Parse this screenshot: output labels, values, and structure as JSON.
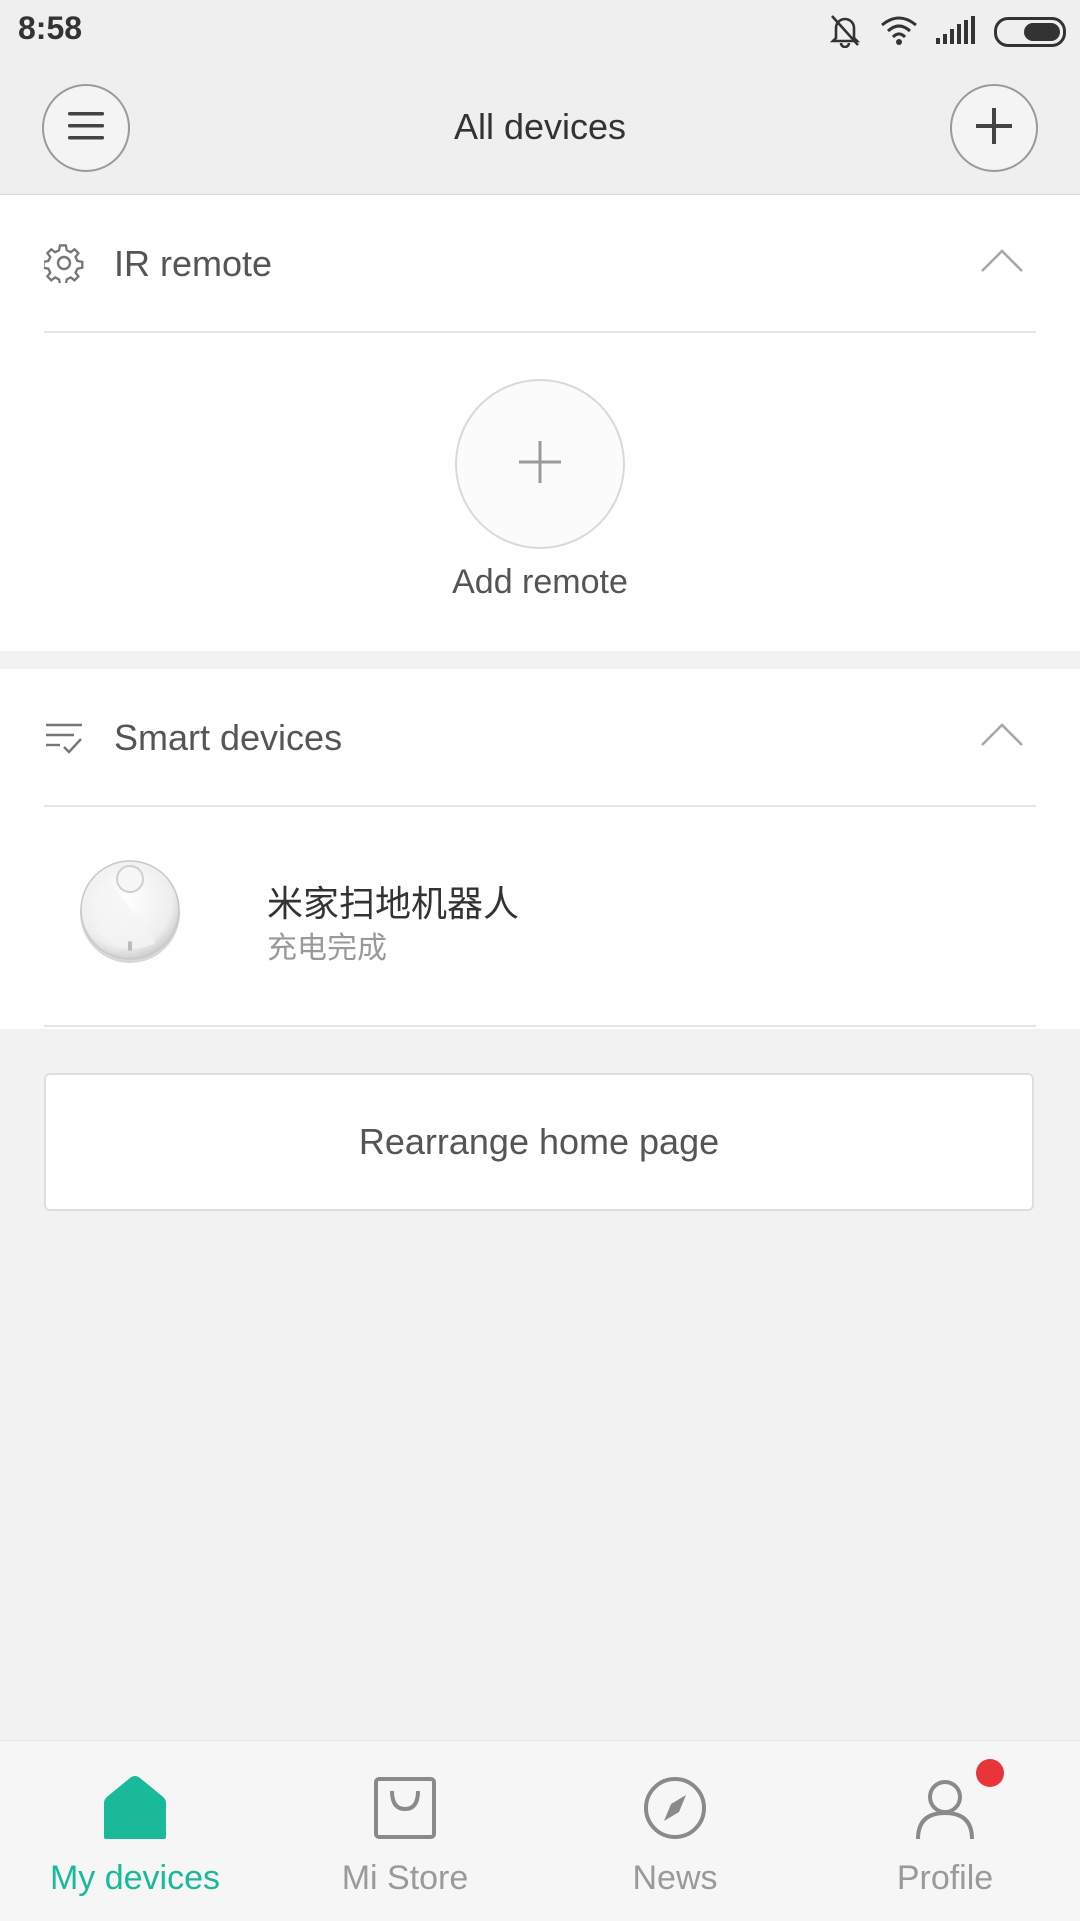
{
  "status_bar": {
    "time": "8:58"
  },
  "header": {
    "title": "All devices"
  },
  "ir_section": {
    "label": "IR remote",
    "add_label": "Add remote"
  },
  "smart_section": {
    "label": "Smart devices",
    "devices": [
      {
        "name": "米家扫地机器人",
        "status": "充电完成"
      }
    ]
  },
  "rearrange_label": "Rearrange home page",
  "tabs": [
    {
      "label": "My devices",
      "icon": "home-icon",
      "active": true
    },
    {
      "label": "Mi Store",
      "icon": "shopping-bag-icon",
      "active": false
    },
    {
      "label": "News",
      "icon": "compass-icon",
      "active": false
    },
    {
      "label": "Profile",
      "icon": "person-icon",
      "active": false
    }
  ],
  "colors": {
    "accent": "#19b99a",
    "badge": "#e8353a"
  }
}
